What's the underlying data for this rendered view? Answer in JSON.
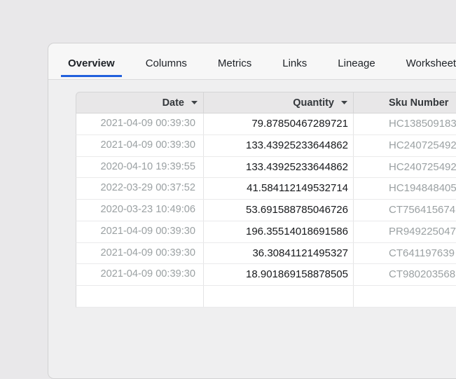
{
  "accent_color": "#2160dd",
  "tabs": [
    {
      "label": "Overview",
      "active": true
    },
    {
      "label": "Columns",
      "active": false
    },
    {
      "label": "Metrics",
      "active": false
    },
    {
      "label": "Links",
      "active": false
    },
    {
      "label": "Lineage",
      "active": false
    },
    {
      "label": "Worksheets",
      "active": false
    }
  ],
  "table": {
    "columns": [
      {
        "label": "Date",
        "has_sort_caret": true
      },
      {
        "label": "Quantity",
        "has_sort_caret": true
      },
      {
        "label": "Sku Number",
        "has_sort_caret": false
      }
    ],
    "rows": [
      {
        "date": "2021-04-09 00:39:30",
        "quantity": "79.87850467289721",
        "sku": "HC138509183"
      },
      {
        "date": "2021-04-09 00:39:30",
        "quantity": "133.43925233644862",
        "sku": "HC240725492"
      },
      {
        "date": "2020-04-10 19:39:55",
        "quantity": "133.43925233644862",
        "sku": "HC240725492"
      },
      {
        "date": "2022-03-29 00:37:52",
        "quantity": "41.584112149532714",
        "sku": "HC194848405"
      },
      {
        "date": "2020-03-23 10:49:06",
        "quantity": "53.691588785046726",
        "sku": "CT756415674"
      },
      {
        "date": "2021-04-09 00:39:30",
        "quantity": "196.35514018691586",
        "sku": "PR949225047"
      },
      {
        "date": "2021-04-09 00:39:30",
        "quantity": "36.30841121495327",
        "sku": "CT641197639"
      },
      {
        "date": "2021-04-09 00:39:30",
        "quantity": "18.901869158878505",
        "sku": "CT980203568"
      }
    ]
  }
}
